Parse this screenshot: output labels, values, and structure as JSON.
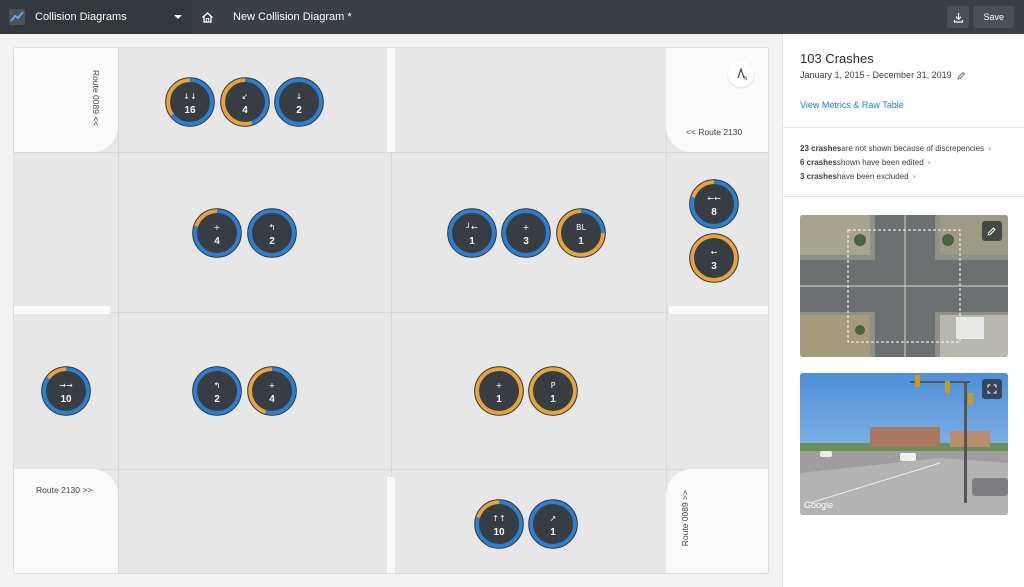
{
  "topbar": {
    "app_title": "Collision Diagrams",
    "doc_title": "New Collision Diagram *",
    "save_label": "Save",
    "icons": [
      "app-logo-icon",
      "chevron-down-icon",
      "home-icon",
      "download-icon"
    ]
  },
  "diagram": {
    "roads": {
      "top_left": "Route 0089",
      "top_right": "Route 2130",
      "bottom_left": "Route 2130",
      "bottom_right": "Route 0089",
      "chevron_left": "<<",
      "chevron_right": ">>"
    },
    "compass_label": "N",
    "colors": {
      "blue": "#2b7fce",
      "orange": "#e8a33a",
      "dark": "#383d43"
    },
    "markers": [
      {
        "id": "m1",
        "icon": "↓↓",
        "count": "16",
        "orange": 0.35
      },
      {
        "id": "m2",
        "icon": "↙",
        "count": "4",
        "orange": 0.55
      },
      {
        "id": "m3",
        "icon": "↓",
        "count": "2",
        "orange": 0.0
      },
      {
        "id": "m4",
        "icon": "+",
        "count": "4",
        "orange": 0.2
      },
      {
        "id": "m5",
        "icon": "↰",
        "count": "2",
        "orange": 0.0
      },
      {
        "id": "m6",
        "icon": "┘←",
        "count": "1",
        "orange": 0.0
      },
      {
        "id": "m7",
        "icon": "+",
        "count": "3",
        "orange": 0.0
      },
      {
        "id": "m8",
        "icon": "BL",
        "count": "1",
        "orange": 0.75
      },
      {
        "id": "m9",
        "icon": "←←",
        "count": "8",
        "orange": 0.2
      },
      {
        "id": "m10",
        "icon": "←",
        "count": "3",
        "orange": 1.0
      },
      {
        "id": "m11",
        "icon": "→→",
        "count": "10",
        "orange": 0.15
      },
      {
        "id": "m12",
        "icon": "↰",
        "count": "2",
        "orange": 0.0
      },
      {
        "id": "m13",
        "icon": "+",
        "count": "4",
        "orange": 0.45
      },
      {
        "id": "m14",
        "icon": "+",
        "count": "1",
        "orange": 1.0
      },
      {
        "id": "m15",
        "icon": "P",
        "count": "1",
        "orange": 1.0
      },
      {
        "id": "m16",
        "icon": "↑↑",
        "count": "10",
        "orange": 0.2
      },
      {
        "id": "m17",
        "icon": "↗",
        "count": "1",
        "orange": 0.0
      }
    ]
  },
  "sidebar": {
    "title": "103 Crashes",
    "date_range": "January 1, 2015 - December 31, 2019",
    "metrics_link": "View Metrics & Raw Table",
    "notes": [
      {
        "bold": "23 crashes",
        "rest": " are not shown because of discrepencies"
      },
      {
        "bold": "6 crashes",
        "rest": " shown have been edited"
      },
      {
        "bold": "3 crashes",
        "rest": " have been excluded"
      }
    ],
    "street_view_label": "Google",
    "icons": [
      "edit-icon",
      "chevron-right-icon",
      "expand-icon"
    ]
  }
}
